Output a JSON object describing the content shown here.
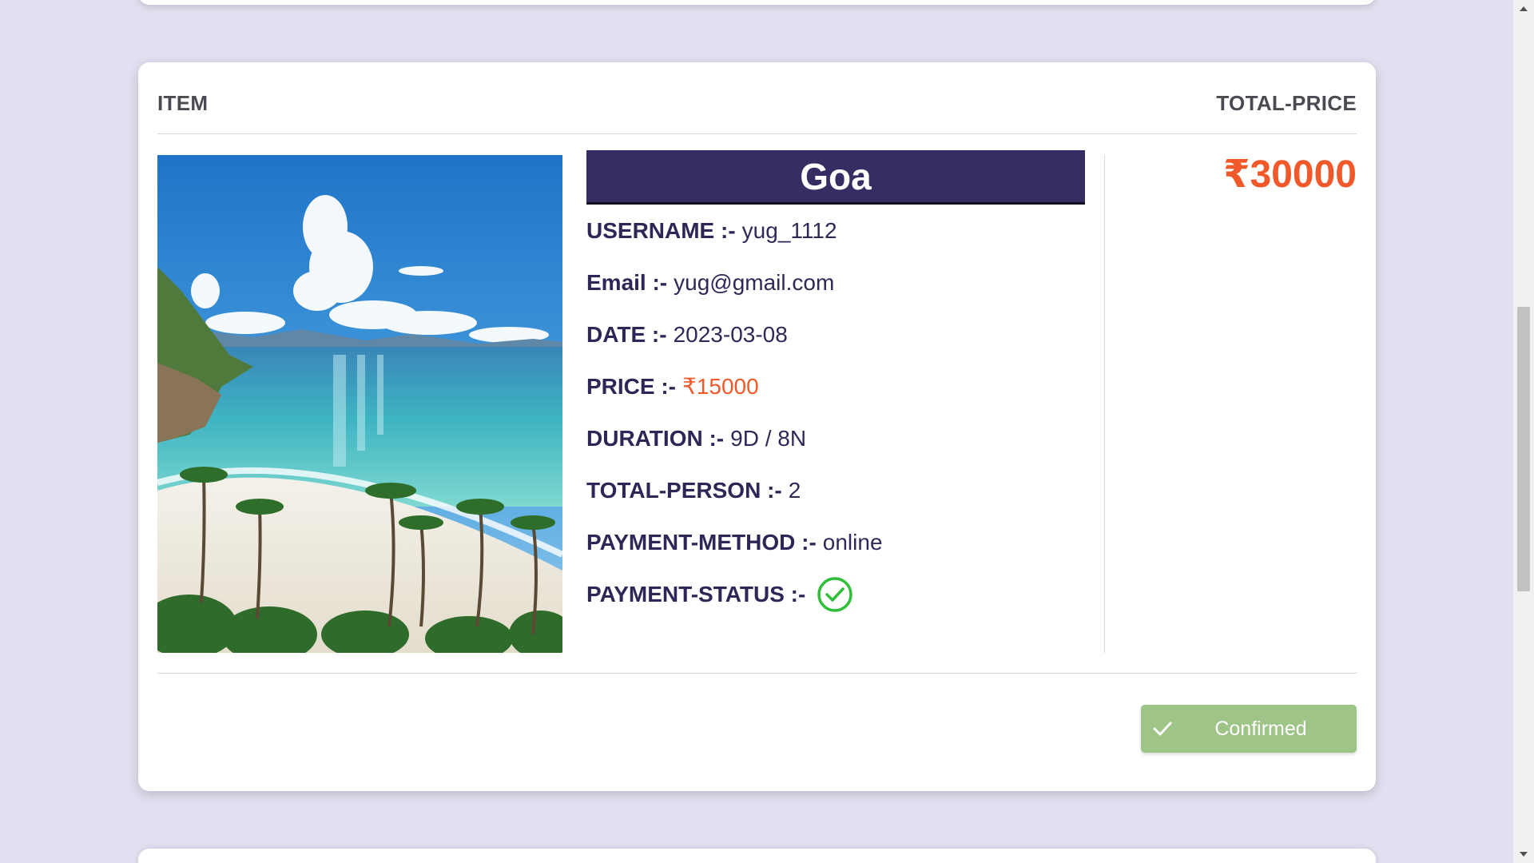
{
  "header": {
    "item_label": "ITEM",
    "total_price_label": "TOTAL-PRICE"
  },
  "package": {
    "title": "Goa",
    "image_icon": "beach-photo",
    "fields": {
      "username": {
        "label": "USERNAME :-",
        "value": "yug_1112"
      },
      "email": {
        "label": "Email :-",
        "value": "yug@gmail.com"
      },
      "date": {
        "label": "DATE :-",
        "value": "2023-03-08"
      },
      "price": {
        "label": "PRICE :-",
        "value": "₹15000"
      },
      "duration": {
        "label": "DURATION :-",
        "value": "9D / 8N"
      },
      "total_person": {
        "label": "TOTAL-PERSON :-",
        "value": "2"
      },
      "payment_method": {
        "label": "PAYMENT-METHOD :-",
        "value": "online"
      },
      "payment_status": {
        "label": "PAYMENT-STATUS :-",
        "icon": "check-circle-icon"
      }
    }
  },
  "total_price": "₹30000",
  "confirm_button": {
    "label": "Confirmed",
    "icon": "check-icon"
  },
  "colors": {
    "background": "#e1e0f0",
    "title_bar": "#372d62",
    "accent_price": "#f2592a",
    "confirmed": "#9ec488",
    "status_ok": "#2fbf3a",
    "label_text": "#2c2757"
  }
}
